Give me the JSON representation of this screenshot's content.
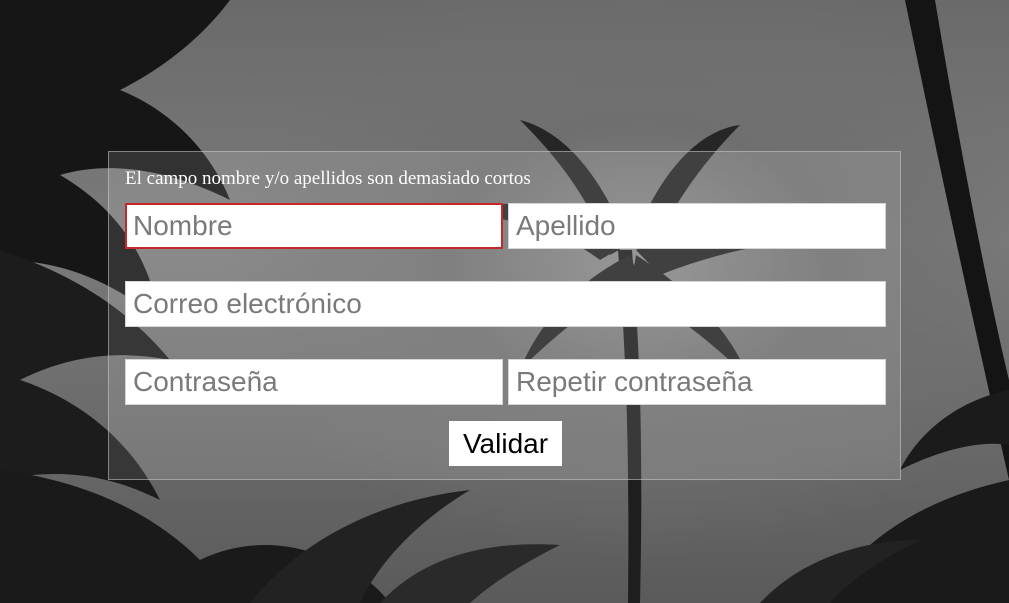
{
  "form": {
    "error_message": "El campo nombre y/o apellidos son demasiado cortos",
    "first_name": {
      "value": "",
      "placeholder": "Nombre",
      "invalid": true
    },
    "last_name": {
      "value": "",
      "placeholder": "Apellido"
    },
    "email": {
      "value": "",
      "placeholder": "Correo electrónico"
    },
    "password": {
      "value": "",
      "placeholder": "Contraseña"
    },
    "password_repeat": {
      "value": "",
      "placeholder": "Repetir contraseña"
    },
    "submit_label": "Validar"
  },
  "colors": {
    "error_border": "#c62828",
    "panel_text": "#ffffff",
    "field_bg": "#ffffff"
  }
}
